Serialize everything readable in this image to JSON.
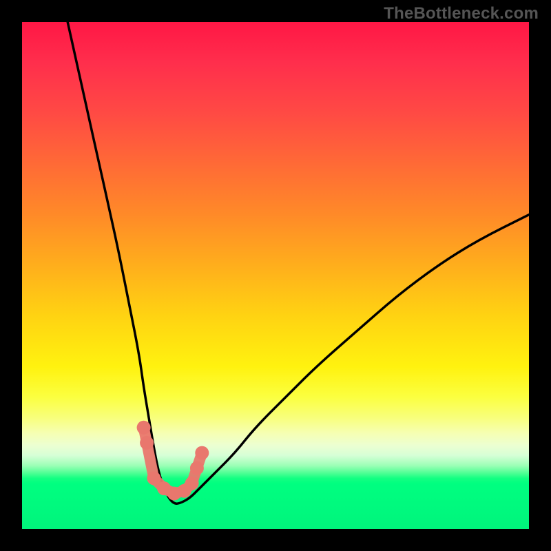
{
  "watermark": "TheBottleneck.com",
  "chart_data": {
    "type": "line",
    "title": "",
    "xlabel": "",
    "ylabel": "",
    "xlim": [
      0,
      100
    ],
    "ylim": [
      0,
      100
    ],
    "series": [
      {
        "name": "bottleneck-curve",
        "x": [
          9,
          11,
          13,
          15,
          17,
          19,
          21,
          23,
          24,
          25,
          26,
          27,
          28,
          29,
          30,
          31,
          33,
          35,
          38,
          42,
          46,
          52,
          58,
          66,
          74,
          82,
          90,
          100
        ],
        "y": [
          100,
          91,
          82,
          73,
          64,
          55,
          45,
          35,
          28,
          22,
          16,
          11,
          8,
          6,
          5,
          5,
          6,
          8,
          11,
          15,
          20,
          26,
          32,
          39,
          46,
          52,
          57,
          62
        ]
      }
    ],
    "markers": {
      "name": "range-highlight",
      "color": "#e9776d",
      "style": "dots",
      "x": [
        24,
        24.6,
        26,
        28,
        30,
        32,
        33.5,
        34.5,
        35.5
      ],
      "y": [
        20,
        17,
        10,
        8,
        7,
        7.5,
        9,
        12,
        15
      ]
    },
    "background": {
      "type": "gradient-vertical",
      "description": "spectral gradient mapping high values to red, mid to yellow, low to green, representing bottleneck severity",
      "stops": [
        {
          "pos": 0.0,
          "color": "#ff1745"
        },
        {
          "pos": 0.3,
          "color": "#ff7a2e"
        },
        {
          "pos": 0.6,
          "color": "#ffe812"
        },
        {
          "pos": 0.82,
          "color": "#f6ffb1"
        },
        {
          "pos": 0.9,
          "color": "#14ff82"
        },
        {
          "pos": 1.0,
          "color": "#00f47c"
        }
      ]
    }
  }
}
